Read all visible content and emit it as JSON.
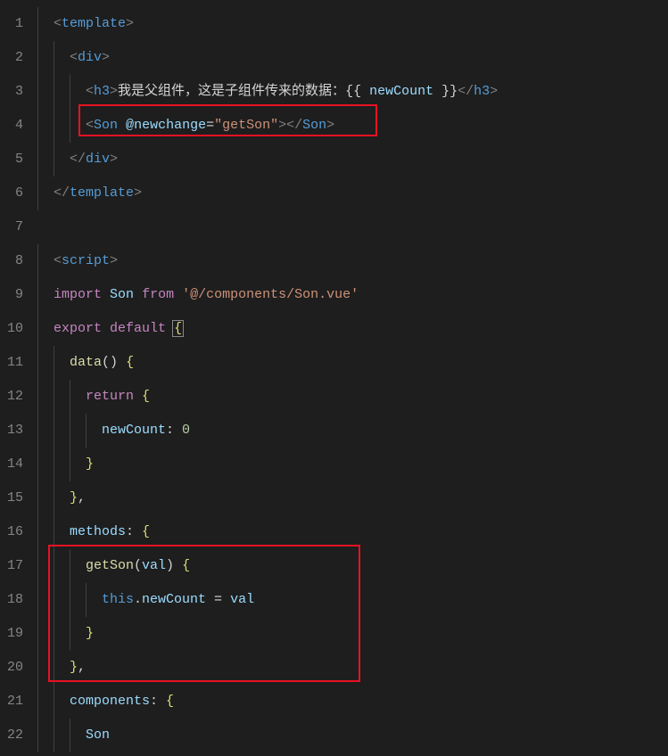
{
  "lineNumbers": [
    "1",
    "2",
    "3",
    "4",
    "5",
    "6",
    "7",
    "8",
    "9",
    "10",
    "11",
    "12",
    "13",
    "14",
    "15",
    "16",
    "17",
    "18",
    "19",
    "20",
    "21",
    "22"
  ],
  "t": {
    "template": "template",
    "div": "div",
    "h3": "h3",
    "Son": "Son",
    "script": "script",
    "import": "import",
    "from": "from",
    "export": "export",
    "default": "default",
    "return": "return",
    "this": "this",
    "data": "data",
    "methods": "methods",
    "components": "components",
    "getSon": "getSon",
    "val": "val",
    "newCount": "newCount",
    "newchange": "newchange",
    "getSonStr": "\"getSon\"",
    "importPath": "'@/components/Son.vue'",
    "zero": "0",
    "h3text": "我是父组件，这是子组件传来的数据：",
    "lt": "<",
    "gt": ">",
    "ltSlash": "</",
    "at": "@",
    "eq": "=",
    "dblOpen": "{{ ",
    "dblClose": " }}",
    "braceOpen": "{",
    "braceClose": "}",
    "parenOpen": "(",
    "parenClose": ")",
    "colon": ":",
    "comma": ",",
    "dot": ".",
    "space": " ",
    "assign": " = "
  }
}
